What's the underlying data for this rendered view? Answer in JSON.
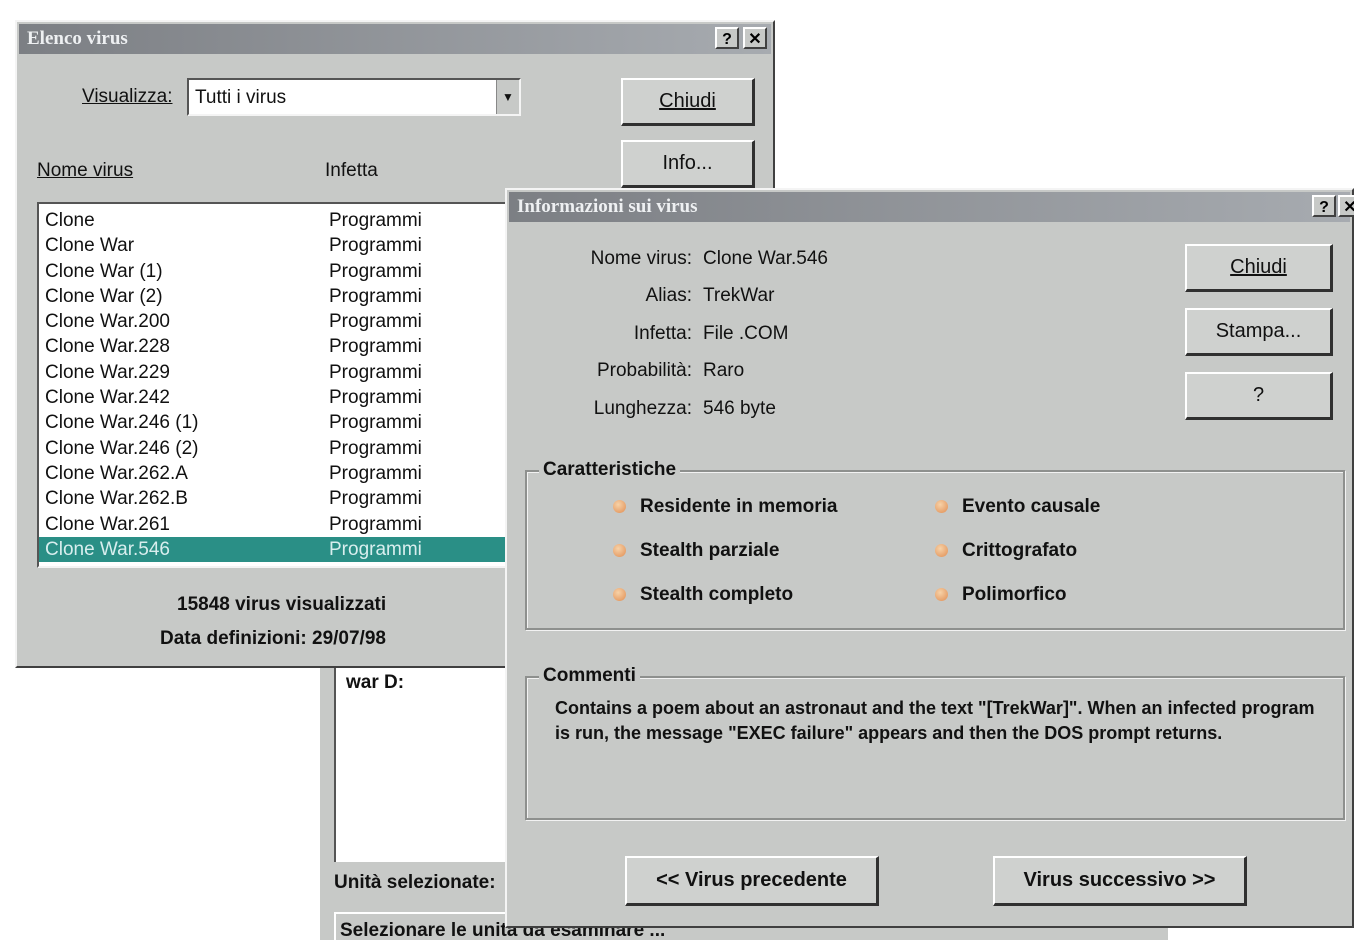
{
  "list_window": {
    "title": "Elenco virus",
    "view_label": "Visualizza:",
    "view_value": "Tutti i virus",
    "close_button": "Chiudi",
    "info_button": "Info...",
    "col_name": "Nome virus",
    "col_infects": "Infetta",
    "rows": [
      {
        "name": "Clone",
        "infects": "Programmi"
      },
      {
        "name": "Clone War",
        "infects": "Programmi"
      },
      {
        "name": "Clone War (1)",
        "infects": "Programmi"
      },
      {
        "name": "Clone War (2)",
        "infects": "Programmi"
      },
      {
        "name": "Clone War.200",
        "infects": "Programmi"
      },
      {
        "name": "Clone War.228",
        "infects": "Programmi"
      },
      {
        "name": "Clone War.229",
        "infects": "Programmi"
      },
      {
        "name": "Clone War.242",
        "infects": "Programmi"
      },
      {
        "name": "Clone War.246 (1)",
        "infects": "Programmi"
      },
      {
        "name": "Clone War.246 (2)",
        "infects": "Programmi"
      },
      {
        "name": "Clone War.262.A",
        "infects": "Programmi"
      },
      {
        "name": "Clone War.262.B",
        "infects": "Programmi"
      },
      {
        "name": "Clone War.261",
        "infects": "Programmi"
      },
      {
        "name": "Clone War.546",
        "infects": "Programmi"
      }
    ],
    "count_text": "15848 virus visualizzati",
    "date_text": "Data definizioni: 29/07/98"
  },
  "background": {
    "list_fragment": "war D:",
    "unit_label": "Unità selezionate:",
    "bottom_text": "Selezionare le unità da esaminare ..."
  },
  "info_window": {
    "title": "Informazioni sui virus",
    "fields": [
      {
        "label": "Nome virus:",
        "value": "Clone War.546"
      },
      {
        "label": "Alias:",
        "value": "TrekWar"
      },
      {
        "label": "Infetta:",
        "value": "File .COM"
      },
      {
        "label": "Probabilità:",
        "value": "Raro"
      },
      {
        "label": "Lunghezza:",
        "value": "546 byte"
      }
    ],
    "close_button": "Chiudi",
    "print_button": "Stampa...",
    "help_button": "?",
    "characteristics_title": "Caratteristiche",
    "characteristics": [
      "Residente in memoria",
      "Stealth parziale",
      "Stealth completo",
      "Evento causale",
      "Crittografato",
      "Polimorfico"
    ],
    "comments_title": "Commenti",
    "comments_text": "Contains a poem about an astronaut and the text \"[TrekWar]\". When an infected program is run, the message \"EXEC failure\" appears and then the DOS prompt returns.",
    "prev_button": "<< Virus precedente",
    "next_button": "Virus successivo >>"
  }
}
